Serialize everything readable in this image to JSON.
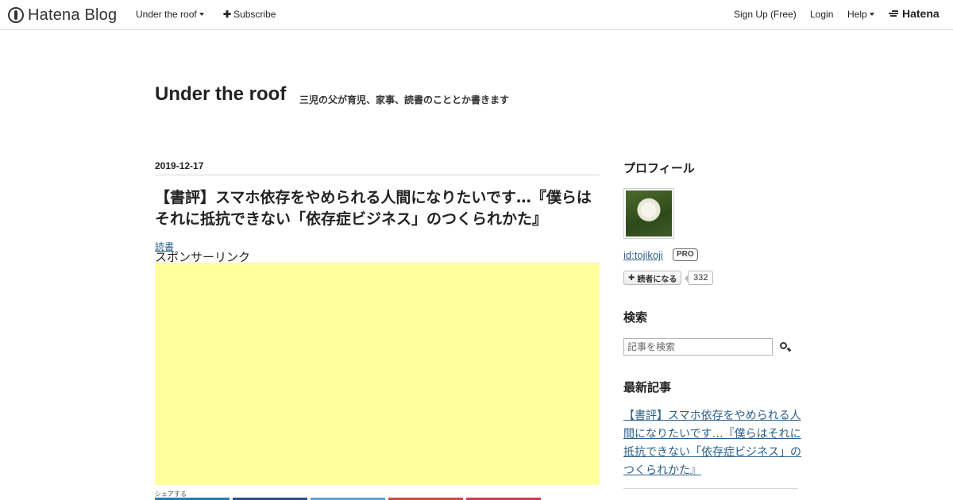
{
  "global_header": {
    "logo_text": "Hatena Blog",
    "blog_menu": "Under the roof",
    "subscribe": "Subscribe",
    "signup": "Sign Up (Free)",
    "login": "Login",
    "help": "Help",
    "hatena": "Hatena"
  },
  "blog": {
    "title": "Under the roof",
    "description": "三児の父が育児、家事、読書のこととか書きます"
  },
  "entry": {
    "date": "2019-12-17",
    "title": "【書評】スマホ依存をやめられる人間になりたいです…『僕らはそれに抵抗できない「依存症ビジネス」のつくられかた』",
    "category": "読書",
    "sponsor_label": "スポンサーリンク",
    "share_label": "シェアする",
    "share_colors": [
      "#1d7fb5",
      "#2b4f8e",
      "#5aa3d6",
      "#cf4a3f",
      "#d4394f"
    ]
  },
  "sidebar": {
    "profile_heading": "プロフィール",
    "profile_id": "id:tojikoji",
    "pro_badge": "PRO",
    "reader_button": "読者になる",
    "reader_count": "332",
    "search_heading": "検索",
    "search_placeholder": "記事を検索",
    "recent_heading": "最新記事",
    "recent_entry": "【書評】スマホ依存をやめられる人間になりたいです…『僕らはそれに抵抗できない「依存症ビジネス」のつくられかた』"
  },
  "colors": {
    "ad_background": "#ffff9e",
    "link": "#2b5f8a"
  }
}
